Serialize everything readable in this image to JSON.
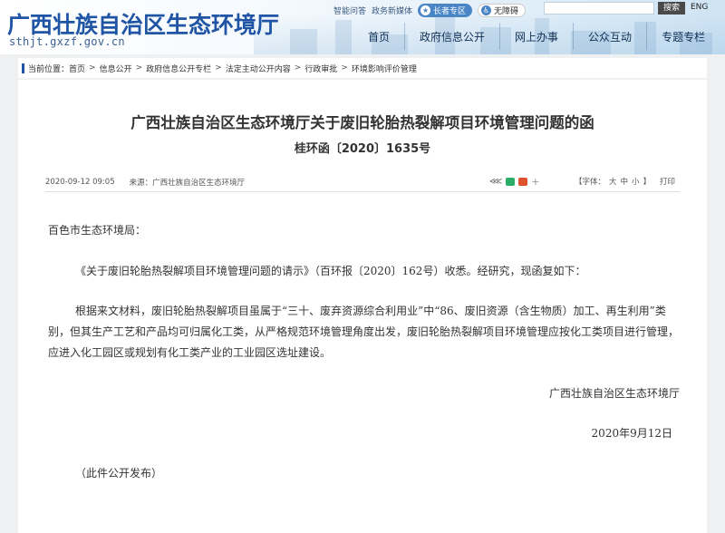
{
  "header": {
    "site_title": "广西壮族自治区生态环境厅",
    "domain": "sthjt.gxzf.gov.cn",
    "top_links": [
      "智能问答",
      "政务新媒体"
    ],
    "elder_label": "长者专区",
    "accessible_label": "无障碍",
    "search_placeholder": "",
    "search_button": "搜索",
    "english_label": "ENG",
    "nav": [
      "首页",
      "政府信息公开",
      "网上办事",
      "公众互动",
      "专题专栏"
    ]
  },
  "breadcrumb": {
    "prefix": "当前位置：",
    "items": [
      "首页",
      "信息公开",
      "政府信息公开专栏",
      "法定主动公开内容",
      "行政审批",
      "环境影响评价管理"
    ]
  },
  "article": {
    "title": "广西壮族自治区生态环境厅关于废旧轮胎热裂解项目环境管理问题的函",
    "doc_number": "桂环函〔2020〕1635号",
    "date": "2020-09-12 09:05",
    "source": "来源：广西壮族自治区生态环境厅",
    "font_label": "【字体：",
    "font_options": [
      "大",
      "中",
      "小"
    ],
    "font_close": "】",
    "print": "打印",
    "share_more": "+",
    "greeting": "百色市生态环境局：",
    "para1": "《关于废旧轮胎热裂解项目环境管理问题的请示》（百环报〔2020〕162号）收悉。经研究，现函复如下：",
    "para2": "根据来文材料，废旧轮胎热裂解项目虽属于“三十、废弃资源综合利用业”中“86、废旧资源（含生物质）加工、再生利用”类别，但其生产工艺和产品均可归属化工类，从严格规范环境管理角度出发，废旧轮胎热裂解项目环境管理应按化工类项目进行管理，应进入化工园区或规划有化工类产业的工业园区选址建设。",
    "signature": "广西壮族自治区生态环境厅",
    "sign_date": "2020年9月12日",
    "notice": "（此件公开发布）"
  },
  "colors": {
    "brand": "#1f55a4",
    "elder_pill": "#4a86c5",
    "wechat": "#2aae67",
    "weibo": "#e0522e"
  }
}
